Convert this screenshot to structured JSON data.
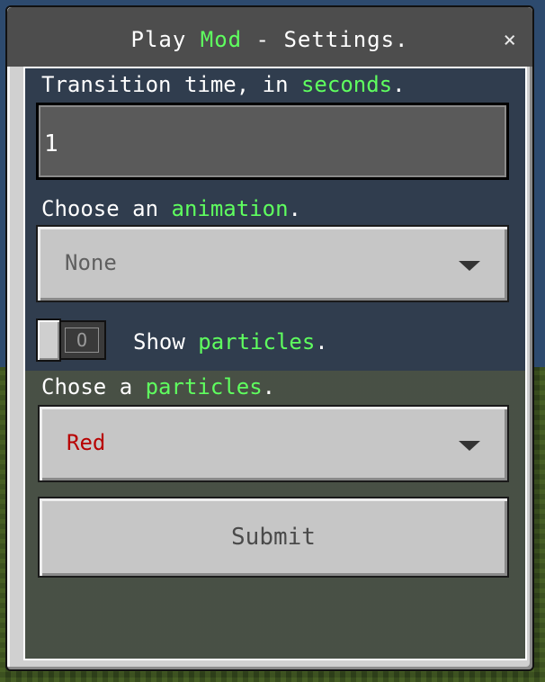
{
  "window": {
    "title_part1": "Play ",
    "title_highlight": "Mod",
    "title_part2": " - Settings.",
    "close_glyph": "×"
  },
  "fields": {
    "transition": {
      "label_prefix": "Transition time, in ",
      "label_highlight": "seconds",
      "label_suffix": ".",
      "value": "1"
    },
    "animation": {
      "label_prefix": "Choose an ",
      "label_highlight": "animation",
      "label_suffix": ".",
      "selected": "None"
    },
    "show_particles": {
      "state_label": "O",
      "label_prefix": "Show ",
      "label_highlight": "particles",
      "label_suffix": ".",
      "enabled": false
    },
    "particles": {
      "label_prefix": "Chose a ",
      "label_highlight": "particles",
      "label_suffix": ".",
      "selected": "Red",
      "selected_color": "#b80000"
    }
  },
  "submit_label": "Submit",
  "colors": {
    "highlight": "#5fff5f",
    "animation_value": "#5f5f5f"
  }
}
